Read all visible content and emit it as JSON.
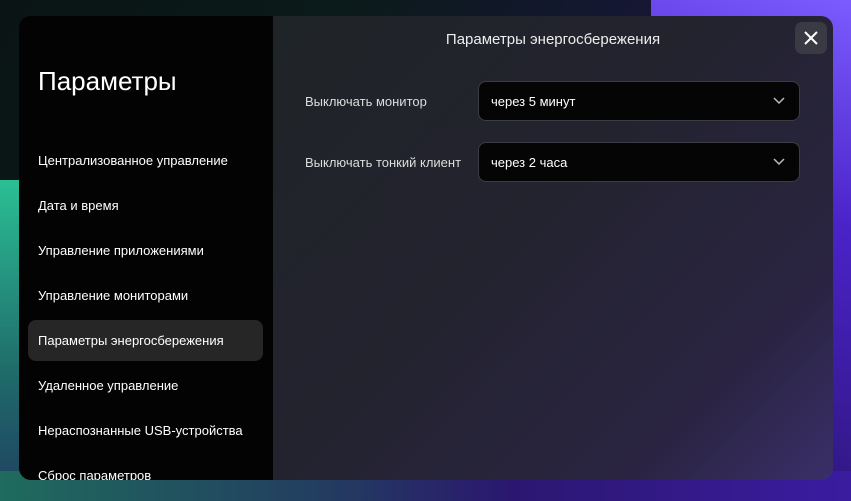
{
  "sidebar": {
    "title": "Параметры",
    "items": [
      {
        "label": "Централизованное управление"
      },
      {
        "label": "Дата и время"
      },
      {
        "label": "Управление приложениями"
      },
      {
        "label": "Управление мониторами"
      },
      {
        "label": "Параметры энергосбережения",
        "active": true
      },
      {
        "label": "Удаленное управление"
      },
      {
        "label": "Нераспознанные USB-устройства"
      },
      {
        "label": "Сброс параметров"
      }
    ]
  },
  "main": {
    "title": "Параметры энергосбережения",
    "settings": [
      {
        "label": "Выключать монитор",
        "value": "через 5 минут"
      },
      {
        "label": "Выключать тонкий клиент",
        "value": "через 2 часа"
      }
    ]
  }
}
